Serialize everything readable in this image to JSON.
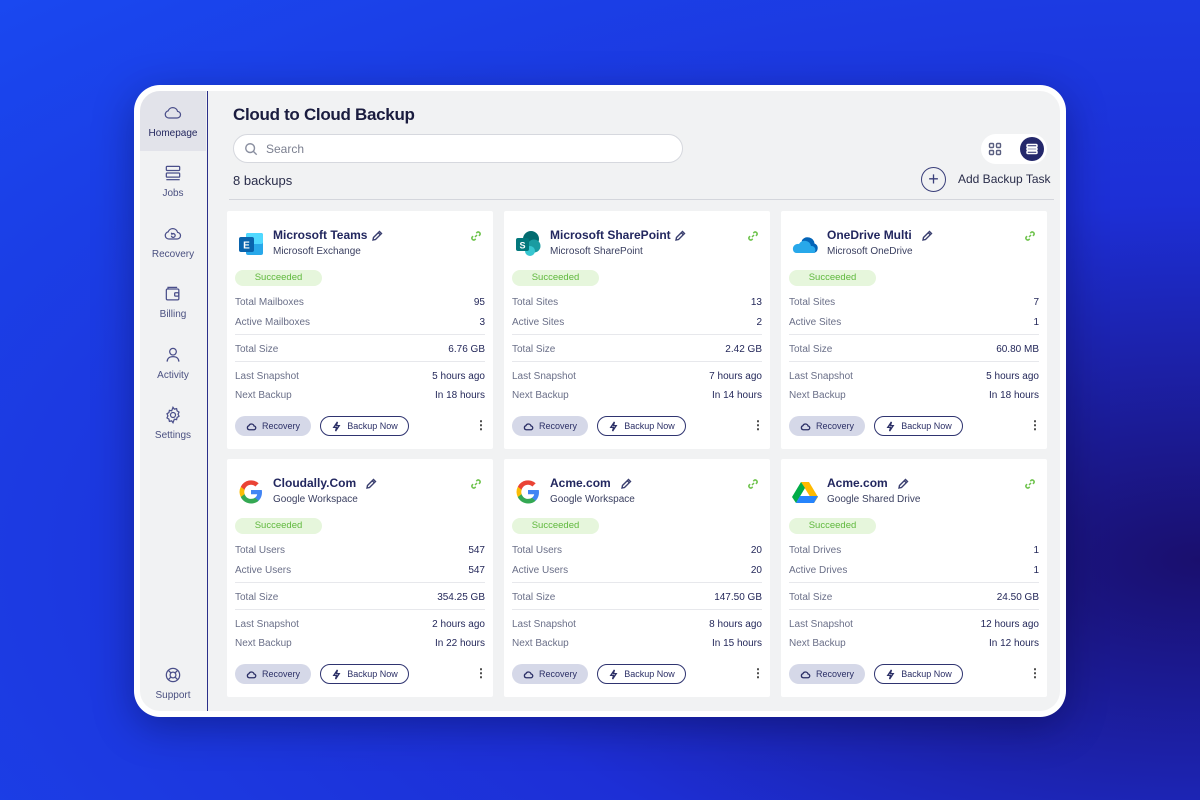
{
  "app": {
    "title": "Cloud to Cloud Backup"
  },
  "sidebar": {
    "items": [
      {
        "label": "Homepage",
        "icon": "cloud-icon"
      },
      {
        "label": "Jobs",
        "icon": "stack-icon"
      },
      {
        "label": "Recovery",
        "icon": "cloud-refresh-icon"
      },
      {
        "label": "Billing",
        "icon": "wallet-icon"
      },
      {
        "label": "Activity",
        "icon": "user-icon"
      },
      {
        "label": "Settings",
        "icon": "gear-icon"
      }
    ],
    "support": {
      "label": "Support",
      "icon": "lifebuoy-icon"
    }
  },
  "search": {
    "placeholder": "Search",
    "value": ""
  },
  "summary": {
    "count_text": "8 backups"
  },
  "toolbar": {
    "add_label": "Add Backup Task",
    "add_symbol": "+"
  },
  "cards": [
    {
      "name": "Microsoft Teams",
      "service": "Microsoft Exchange",
      "logo": "exchange-logo",
      "status": "Succeeded",
      "stat1_label": "Total Mailboxes",
      "stat1_value": "95",
      "stat2_label": "Active Mailboxes",
      "stat2_value": "3",
      "size_label": "Total Size",
      "size_value": "6.76 GB",
      "snapshot_label": "Last Snapshot",
      "snapshot_value": "5 hours ago",
      "next_label": "Next Backup",
      "next_value": "In 18 hours",
      "recovery_label": "Recovery",
      "backup_label": "Backup Now"
    },
    {
      "name": "Microsoft SharePoint",
      "service": "Microsoft SharePoint",
      "logo": "sharepoint-logo",
      "status": "Succeeded",
      "stat1_label": "Total Sites",
      "stat1_value": "13",
      "stat2_label": "Active Sites",
      "stat2_value": "2",
      "size_label": "Total Size",
      "size_value": "2.42 GB",
      "snapshot_label": "Last Snapshot",
      "snapshot_value": "7 hours ago",
      "next_label": "Next Backup",
      "next_value": "In 14 hours",
      "recovery_label": "Recovery",
      "backup_label": "Backup Now"
    },
    {
      "name": "OneDrive Multi",
      "service": "Microsoft OneDrive",
      "logo": "onedrive-logo",
      "status": "Succeeded",
      "stat1_label": "Total Sites",
      "stat1_value": "7",
      "stat2_label": "Active Sites",
      "stat2_value": "1",
      "size_label": "Total Size",
      "size_value": "60.80 MB",
      "snapshot_label": "Last Snapshot",
      "snapshot_value": "5 hours ago",
      "next_label": "Next Backup",
      "next_value": "In 18 hours",
      "recovery_label": "Recovery",
      "backup_label": "Backup Now"
    },
    {
      "name": "Cloudally.Com",
      "service": "Google Workspace",
      "logo": "google-logo",
      "status": "Succeeded",
      "stat1_label": "Total Users",
      "stat1_value": "547",
      "stat2_label": "Active Users",
      "stat2_value": "547",
      "size_label": "Total Size",
      "size_value": "354.25 GB",
      "snapshot_label": "Last Snapshot",
      "snapshot_value": "2 hours ago",
      "next_label": "Next Backup",
      "next_value": "In 22 hours",
      "recovery_label": "Recovery",
      "backup_label": "Backup Now"
    },
    {
      "name": "Acme.com",
      "service": "Google Workspace",
      "logo": "google-logo",
      "status": "Succeeded",
      "stat1_label": "Total Users",
      "stat1_value": "20",
      "stat2_label": "Active Users",
      "stat2_value": "20",
      "size_label": "Total Size",
      "size_value": "147.50 GB",
      "snapshot_label": "Last Snapshot",
      "snapshot_value": "8 hours ago",
      "next_label": "Next Backup",
      "next_value": "In 15 hours",
      "recovery_label": "Recovery",
      "backup_label": "Backup Now"
    },
    {
      "name": "Acme.com",
      "service": "Google Shared Drive",
      "logo": "google-drive-logo",
      "status": "Succeeded",
      "stat1_label": "Total Drives",
      "stat1_value": "1",
      "stat2_label": "Active Drives",
      "stat2_value": "1",
      "size_label": "Total Size",
      "size_value": "24.50 GB",
      "snapshot_label": "Last Snapshot",
      "snapshot_value": "12 hours ago",
      "next_label": "Next Backup",
      "next_value": "In 12 hours",
      "recovery_label": "Recovery",
      "backup_label": "Backup Now"
    }
  ],
  "colors": {
    "accent": "#24286b",
    "status_green": "#5fb83d",
    "status_bg": "#e6f6dc",
    "background_blue": "#1d2fd6"
  }
}
